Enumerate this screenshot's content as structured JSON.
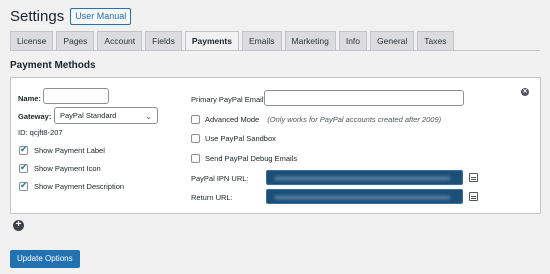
{
  "header": {
    "title": "Settings",
    "manual_button": "User Manual"
  },
  "tabs": [
    {
      "label": "License"
    },
    {
      "label": "Pages"
    },
    {
      "label": "Account"
    },
    {
      "label": "Fields"
    },
    {
      "label": "Payments",
      "active": true
    },
    {
      "label": "Emails"
    },
    {
      "label": "Marketing"
    },
    {
      "label": "Info"
    },
    {
      "label": "General"
    },
    {
      "label": "Taxes"
    }
  ],
  "section": {
    "title": "Payment Methods"
  },
  "gateway_form": {
    "name_label": "Name:",
    "name_value": "",
    "gateway_label": "Gateway:",
    "gateway_selected": "PayPal Standard",
    "id_text": "ID: qcjft8-207",
    "options": [
      {
        "label": "Show Payment Label",
        "checked": true
      },
      {
        "label": "Show Payment Icon",
        "checked": true
      },
      {
        "label": "Show Payment Description",
        "checked": true
      }
    ],
    "email_label": "Primary PayPal Email*:",
    "email_value": "",
    "advanced_mode": {
      "label": "Advanced Mode",
      "note": "(Only works for PayPal accounts created after 2009)",
      "checked": false
    },
    "sandbox": {
      "label": "Use PayPal Sandbox",
      "checked": false
    },
    "debug": {
      "label": "Send PayPal Debug Emails",
      "checked": false
    },
    "ipn_label": "PayPal IPN URL:",
    "return_label": "Return URL:"
  },
  "footer": {
    "update_button": "Update Options"
  }
}
